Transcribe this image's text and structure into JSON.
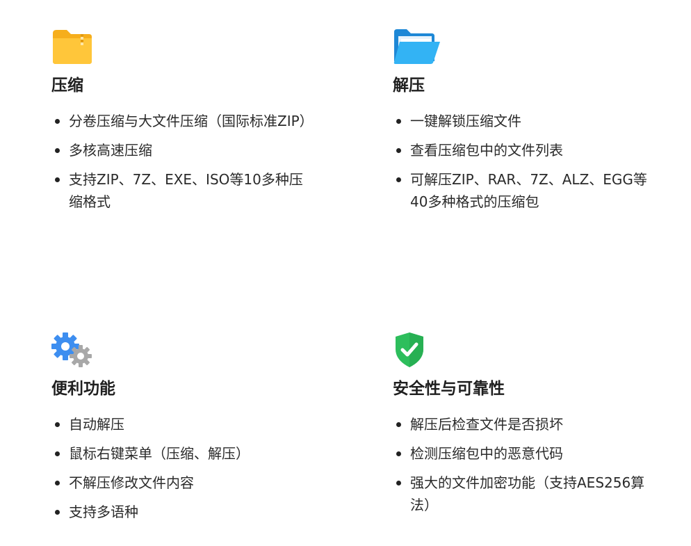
{
  "features": [
    {
      "icon": "folder-icon",
      "icon_color": "#FFC233",
      "title": "压缩",
      "items": [
        "分卷压缩与大文件压缩（国际标准ZIP）",
        "多核高速压缩",
        "支持ZIP、7Z、EXE、ISO等10多种压缩格式"
      ]
    },
    {
      "icon": "open-folder-icon",
      "icon_color": "#2FA6F0",
      "title": "解压",
      "items": [
        "一键解锁压缩文件",
        "查看压缩包中的文件列表",
        "可解压ZIP、RAR、7Z、ALZ、EGG等40多种格式的压缩包"
      ]
    },
    {
      "icon": "gears-icon",
      "icon_color": "#3D8EF0",
      "title": "便利功能",
      "items": [
        "自动解压",
        "鼠标右键菜单（压缩、解压）",
        "不解压修改文件内容",
        "支持多语种"
      ]
    },
    {
      "icon": "shield-check-icon",
      "icon_color": "#2DBE5C",
      "title": "安全性与可靠性",
      "items": [
        "解压后检查文件是否损坏",
        "检测压缩包中的恶意代码",
        "强大的文件加密功能（支持AES256算法）"
      ]
    }
  ]
}
